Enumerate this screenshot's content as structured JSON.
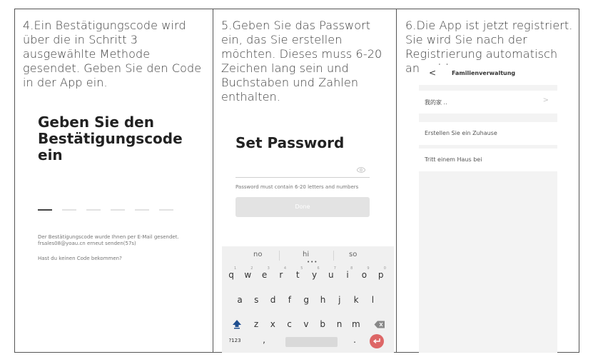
{
  "col1": {
    "step_text": "4.Ein Bestätigungscode wird über die in Schritt 3 ausgewählte Methode gesendet. Geben Sie den Code in der App ein.",
    "heading": "Geben Sie den Bestätigungscode ein",
    "info_text": "Der Bestätigungscode wurde Ihnen per E-Mail gesendet. frsales08@yoau.cn  erneut senden(57s)",
    "no_code_link": "Hast du keinen Code bekommen?"
  },
  "col2": {
    "step_text": "5.Geben Sie das Passwort ein, das Sie erstellen möchten. Dieses muss 6-20 Zeichen lang sein und Buchstaben und Zahlen enthalten.",
    "heading": "Set Password",
    "hint": "Password must contain 6-20 letters and numbers",
    "done_label": "Done",
    "keyboard": {
      "suggestions": [
        "no",
        "hi",
        "so"
      ],
      "row1": [
        "q",
        "w",
        "e",
        "r",
        "t",
        "y",
        "u",
        "i",
        "o",
        "p"
      ],
      "row1_nums": [
        "1",
        "2",
        "3",
        "4",
        "5",
        "6",
        "7",
        "8",
        "9",
        "0"
      ],
      "row2": [
        "a",
        "s",
        "d",
        "f",
        "g",
        "h",
        "j",
        "k",
        "l"
      ],
      "row3": [
        "z",
        "x",
        "c",
        "v",
        "b",
        "n",
        "m"
      ],
      "sym_label": "?123",
      "comma": ",",
      "period": "."
    }
  },
  "col3": {
    "step_text": "6.Die App ist jetzt registriert. Sie wird Sie nach der Registrierung automatisch anmelden.",
    "back_glyph": "<",
    "title": "Familienverwaltung",
    "home_item": "我的家 ..",
    "create_home": "Erstellen Sie ein Zuhause",
    "join_home": "Tritt einem Haus bei",
    "chevron": ">"
  }
}
